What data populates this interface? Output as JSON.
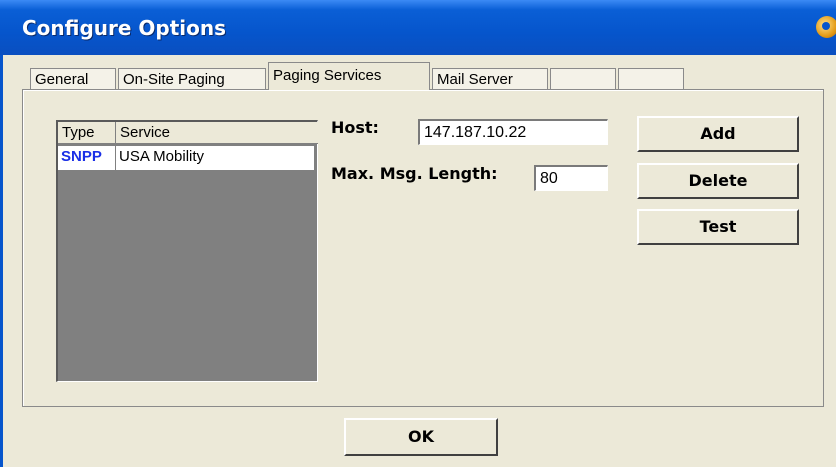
{
  "window": {
    "title": "Configure Options",
    "title_icon": "app-icon"
  },
  "tabs": [
    {
      "label": "General"
    },
    {
      "label": "On-Site Paging"
    },
    {
      "label": "Paging Services",
      "selected": true
    },
    {
      "label": "Mail Server"
    },
    {
      "label": ""
    },
    {
      "label": ""
    }
  ],
  "services": {
    "headers": {
      "type": "Type",
      "service": "Service"
    },
    "rows": [
      {
        "type": "SNPP",
        "service": "USA Mobility"
      }
    ]
  },
  "form": {
    "host_label": "Host:",
    "host_value": "147.187.10.22",
    "max_length_label": "Max. Msg. Length:",
    "max_length_value": "80"
  },
  "buttons": {
    "add": "Add",
    "delete": "Delete",
    "test": "Test",
    "ok": "OK"
  },
  "colors": {
    "titlebar": "#0655cc",
    "type_text": "#1a2fe6",
    "list_background": "#808080",
    "window_background": "#ece9d8"
  }
}
